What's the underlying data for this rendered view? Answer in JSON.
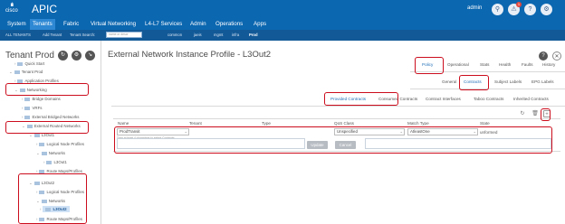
{
  "header": {
    "logo_text": "cisco",
    "app_title": "APIC",
    "user": "admin",
    "notification_count": "1"
  },
  "main_nav": [
    "System",
    "Tenants",
    "Fabric",
    "Virtual Networking",
    "L4-L7 Services",
    "Admin",
    "Operations",
    "Apps"
  ],
  "sub_nav": {
    "all_tenants": "ALL TENANTS",
    "add_tenant": "Add Tenant",
    "tenant_search_label": "Tenant Search:",
    "tenant_search_placeholder": "name or descr",
    "tenants": [
      "common",
      "jaeis",
      "mgmt",
      "infra",
      "Prod"
    ]
  },
  "left_pane": {
    "title": "Tenant Prod",
    "tree": [
      "Quick Start",
      "Tenant Prod",
      "Application Profiles",
      "Networking",
      "Bridge Domains",
      "VRFs",
      "External Bridged Networks",
      "External Routed Networks",
      "L3Out1",
      "Logical Node Profiles",
      "Networks",
      "L3Out1",
      "Route Maps/Profiles",
      "L3Out2",
      "Logical Node Profiles",
      "Networks",
      "L3Out2",
      "Route Maps/Profiles"
    ]
  },
  "main": {
    "title": "External Network Instance Profile - L3Out2",
    "top_tabs": [
      "Policy",
      "Operational",
      "Stats",
      "Health",
      "Faults",
      "History"
    ],
    "second_tabs": [
      "General",
      "Contracts",
      "Subject Labels",
      "EPG Labels"
    ],
    "contract_tabs": [
      "Provided Contracts",
      "Consumed Contracts",
      "Contract Interfaces",
      "Taboo Contracts",
      "Inherited Contracts"
    ],
    "columns": [
      "Name",
      "Tenant",
      "Type",
      "QoS Class",
      "Match Type",
      "State"
    ],
    "row": {
      "name_value": "ProdTransit",
      "name_hint": "Type at least 4 characters to select Contracts",
      "qos": "Unspecified",
      "match_type": "AtleastOne",
      "state": "unformed"
    },
    "buttons": {
      "update": "Update",
      "cancel": "Cancel"
    }
  },
  "colors": {
    "header_bg": "#0c67b1",
    "active_nav": "#2e88d4",
    "subnav_bg": "#125998",
    "highlight": "#cc0d1d",
    "active_tab": "#1f6fb7"
  }
}
